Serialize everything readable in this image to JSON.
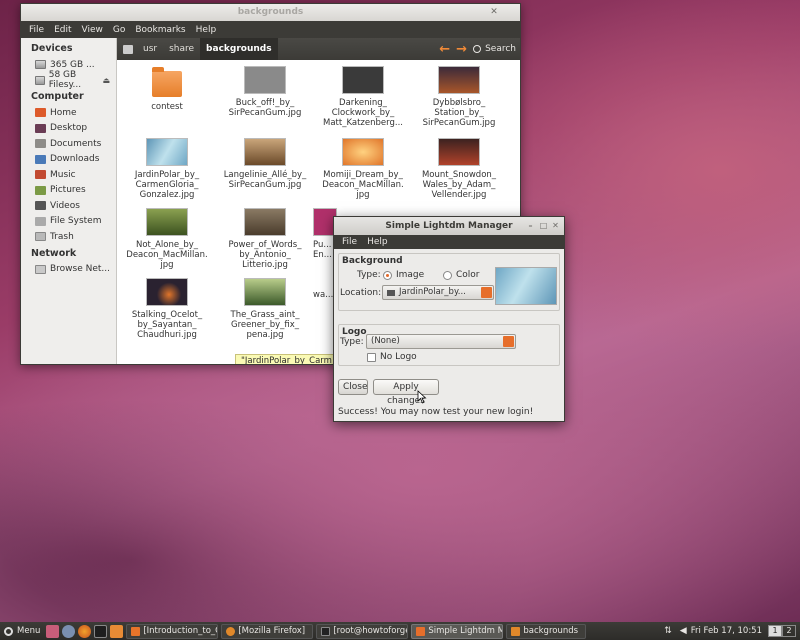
{
  "file_manager": {
    "title": "backgrounds",
    "menu": [
      "File",
      "Edit",
      "View",
      "Go",
      "Bookmarks",
      "Help"
    ],
    "sidebar": {
      "devices_header": "Devices",
      "devices": [
        "365 GB ...",
        "58 GB Filesy..."
      ],
      "computer_header": "Computer",
      "computer": [
        "Home",
        "Desktop",
        "Documents",
        "Downloads",
        "Music",
        "Pictures",
        "Videos",
        "File System",
        "Trash"
      ],
      "network_header": "Network",
      "network": [
        "Browse Net..."
      ]
    },
    "path": [
      "usr",
      "share",
      "backgrounds"
    ],
    "search_label": "Search",
    "files": [
      {
        "name": "contest",
        "type": "folder"
      },
      {
        "name": "Buck_off!_by_ SirPecanGum.jpg",
        "color": "#8a8a8a"
      },
      {
        "name": "Darkening_ Clockwork_by_ Matt_Katzenberg...",
        "color": "#3a3a3a"
      },
      {
        "name": "Dybbølsbro_ Station_by_ SirPecanGum.jpg",
        "color": "#a8562a"
      },
      {
        "name": "JardinPolar_by_ CarmenGloria_ Gonzalez.jpg",
        "color": "#7fb4cc"
      },
      {
        "name": "Langelinie_Allé_by_ SirPecanGum.jpg",
        "color": "#9c6a3a"
      },
      {
        "name": "Momiji_Dream_by_ Deacon_MacMillan. jpg",
        "color": "#e0752a"
      },
      {
        "name": "Mount_Snowdon_ Wales_by_Adam_ Vellender.jpg",
        "color": "#b0422a"
      },
      {
        "name": "Not_Alone_by_ Deacon_MacMillan. jpg",
        "color": "#5a7a30"
      },
      {
        "name": "Power_of_Words_ by_Antonio_ Litterio.jpg",
        "color": "#6b5a44"
      },
      {
        "name": "Pu... En...",
        "color": "#b0306a"
      },
      {
        "name": "",
        "color": "#6a8a3a"
      },
      {
        "name": "Stalking_Ocelot_ by_Sayantan_ Chaudhuri.jpg",
        "color": "#2a2230"
      },
      {
        "name": "The_Grass_aint_ Greener_by_fix_ pena.jpg",
        "color": "#587a3a"
      },
      {
        "name": "wa...",
        "color": "#8aa0b0"
      }
    ],
    "tooltip": "\"JardinPolar_by_Carm"
  },
  "dialog": {
    "title": "Simple Lightdm Manager",
    "menu": [
      "File",
      "Help"
    ],
    "background_group": "Background",
    "type_label": "Type:",
    "type_image": "Image",
    "type_color": "Color",
    "location_label": "Location:",
    "location_value": "JardinPolar_by...",
    "logo_group": "Logo",
    "logo_type_label": "Type:",
    "logo_type_value": "(None)",
    "no_logo_label": "No Logo",
    "close_button": "Close",
    "apply_button": "Apply changes",
    "status": "Success! You may now test your new login!"
  },
  "panel": {
    "menu_label": "Menu",
    "tasks": [
      {
        "label": "[Introduction_to_Cin...",
        "color": "#e8742a"
      },
      {
        "label": "[Mozilla Firefox]",
        "color": "#e0882a"
      },
      {
        "label": "[root@howtoforge-S...",
        "color": "#222222"
      },
      {
        "label": "Simple Lightdm Man...",
        "color": "#e66e2b"
      },
      {
        "label": "backgrounds",
        "color": "#e0882a"
      }
    ],
    "clock": "Fri Feb 17, 10:51",
    "workspaces": [
      "1",
      "2"
    ]
  }
}
